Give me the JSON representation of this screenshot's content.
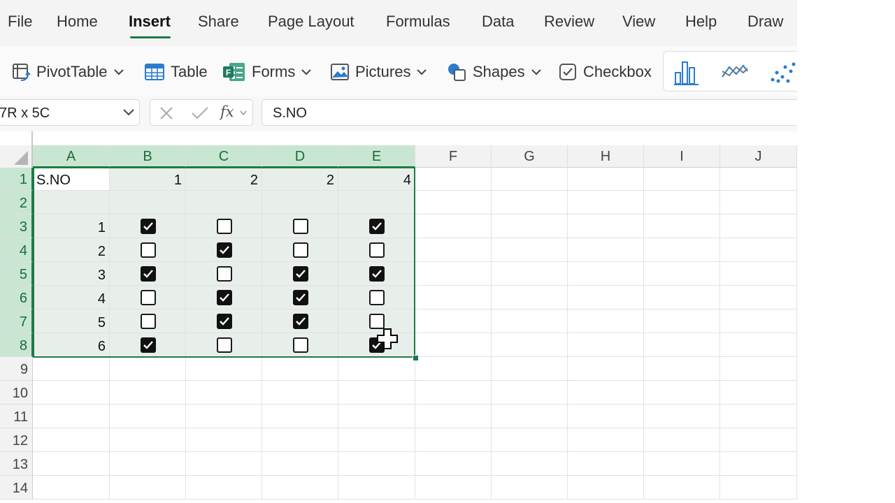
{
  "menu": {
    "tabs": [
      "File",
      "Home",
      "Insert",
      "Share",
      "Page Layout",
      "Formulas",
      "Data",
      "Review",
      "View",
      "Help",
      "Draw"
    ],
    "active_tab": "Insert"
  },
  "ribbon": {
    "pivot_table": "PivotTable",
    "table": "Table",
    "forms": "Forms",
    "pictures": "Pictures",
    "shapes": "Shapes",
    "checkbox": "Checkbox",
    "chart_icons": [
      "column-chart-icon",
      "line-chart-icon",
      "scatter-chart-icon"
    ]
  },
  "formula_bar": {
    "name_box": "7R x 5C",
    "fx_label": "fx",
    "formula": "S.NO"
  },
  "sheet": {
    "columns": [
      "A",
      "B",
      "C",
      "D",
      "E",
      "F",
      "G",
      "H",
      "I",
      "J"
    ],
    "rows": [
      "1",
      "2",
      "3",
      "4",
      "5",
      "6",
      "7",
      "8",
      "9",
      "10",
      "11",
      "12",
      "13",
      "14"
    ],
    "header_row": [
      "S.NO",
      "1",
      "2",
      "2",
      "4"
    ],
    "serials": [
      "1",
      "2",
      "3",
      "4",
      "5",
      "6"
    ],
    "checkboxes": [
      [
        true,
        false,
        false,
        true
      ],
      [
        false,
        true,
        false,
        false
      ],
      [
        true,
        false,
        true,
        true
      ],
      [
        false,
        true,
        true,
        false
      ],
      [
        false,
        true,
        true,
        false
      ],
      [
        true,
        false,
        false,
        true
      ]
    ],
    "selection": "A1:E8",
    "accent_color": "#1e7a45",
    "selection_header_color": "#c9e6d2"
  }
}
